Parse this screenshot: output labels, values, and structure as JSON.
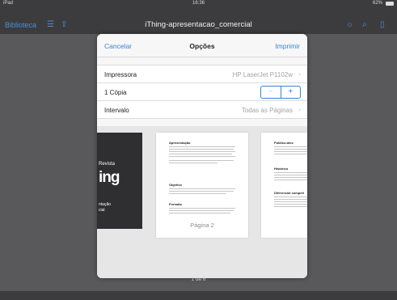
{
  "status_bar": {
    "left": "iPad",
    "time": "16:36",
    "battery": "62%"
  },
  "nav": {
    "back_label": "Biblioteca",
    "title": "iThing-apresentacao_comercial"
  },
  "print_options": {
    "cancel_label": "Cancelar",
    "title": "Opções",
    "print_label": "Imprimir",
    "rows": [
      {
        "label": "Impressora",
        "value": "HP LaserJet P1102w"
      },
      {
        "label": "1 Cópia"
      },
      {
        "label": "Intervalo",
        "value": "Todas as Páginas"
      }
    ],
    "stepper": {
      "minus": "−",
      "plus": "+"
    }
  },
  "preview": {
    "cover": {
      "line1": "Revista",
      "line2": "ing",
      "line3": "ntação\ncial"
    },
    "page2": {
      "headings": [
        "Apresentação",
        "Objetivo",
        "Formato"
      ],
      "label": "Página 2"
    },
    "page3": {
      "headings": [
        "Público-alvo",
        "Histórico",
        "Diferencial competi"
      ]
    }
  },
  "page_counter": "1 de 6"
}
